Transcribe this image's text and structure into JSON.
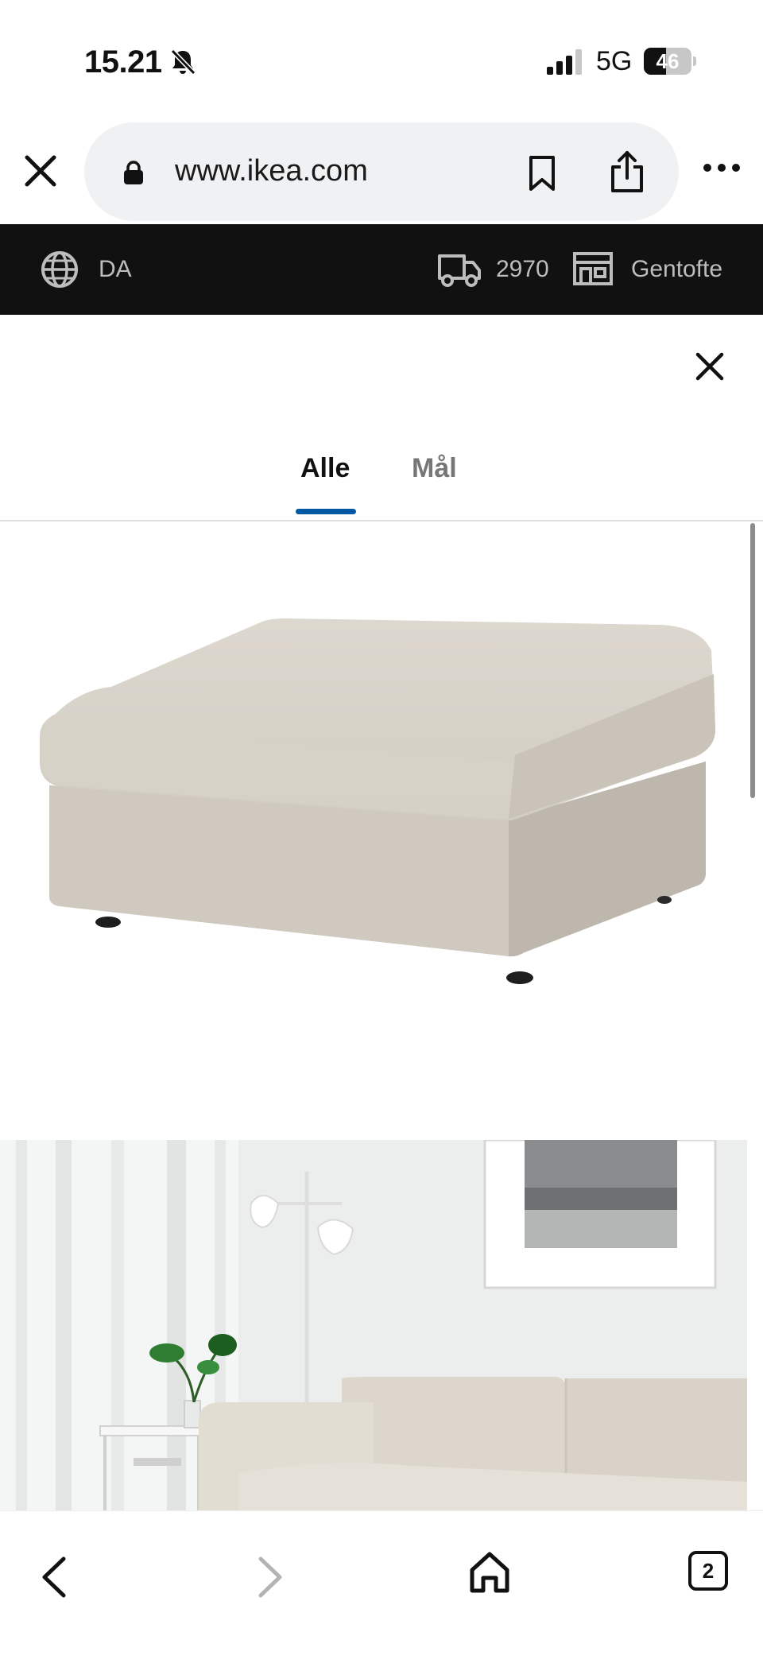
{
  "status_bar": {
    "time": "15.21",
    "network": "5G",
    "battery_percent": "46",
    "battery_level": 0.46
  },
  "browser": {
    "url": "www.ikea.com"
  },
  "ikea_header": {
    "language": "DA",
    "delivery_zip": "2970",
    "store": "Gentofte"
  },
  "modal": {
    "tabs": [
      {
        "label": "Alle",
        "active": true
      },
      {
        "label": "Mål",
        "active": false
      }
    ],
    "accent_color": "#0058a3"
  },
  "bottom_bar": {
    "tab_count": "2"
  },
  "icons": [
    "bell-slash-icon",
    "signal-icon",
    "battery-icon",
    "close-icon",
    "lock-icon",
    "bookmark-icon",
    "share-icon",
    "more-icon",
    "globe-icon",
    "truck-icon",
    "store-icon",
    "chevron-left-icon",
    "chevron-right-icon",
    "home-icon",
    "tabs-icon"
  ]
}
